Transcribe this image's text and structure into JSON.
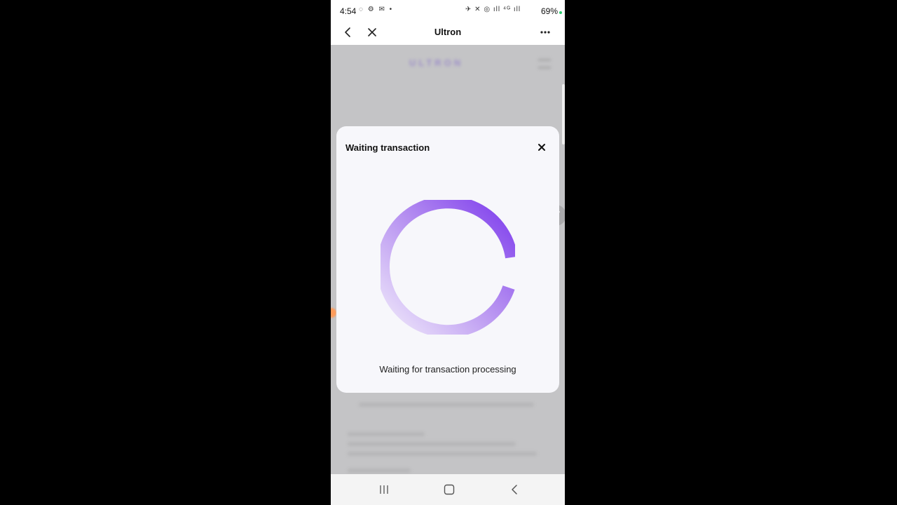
{
  "status_bar": {
    "time": "4:54",
    "left_icons": "◌ ⚙ ✉ •",
    "right_icons": "✈ ✕ ◎ ıll ⁴ᴳ ıll",
    "battery": "69%",
    "battery_icon": "battery-icon"
  },
  "app_bar": {
    "title": "Ultron",
    "back_icon": "chevron-left-icon",
    "close_icon": "close-icon",
    "more_icon": "more-horizontal-icon"
  },
  "background_page": {
    "logo_text": "ULTRON"
  },
  "modal": {
    "title": "Waiting transaction",
    "message": "Waiting for transaction processing",
    "close_icon": "close-icon",
    "spinner_color": "#7c3aed"
  },
  "nav_bar": {
    "recent_icon": "recent-apps-icon",
    "home_icon": "home-icon",
    "back_icon": "back-icon"
  }
}
